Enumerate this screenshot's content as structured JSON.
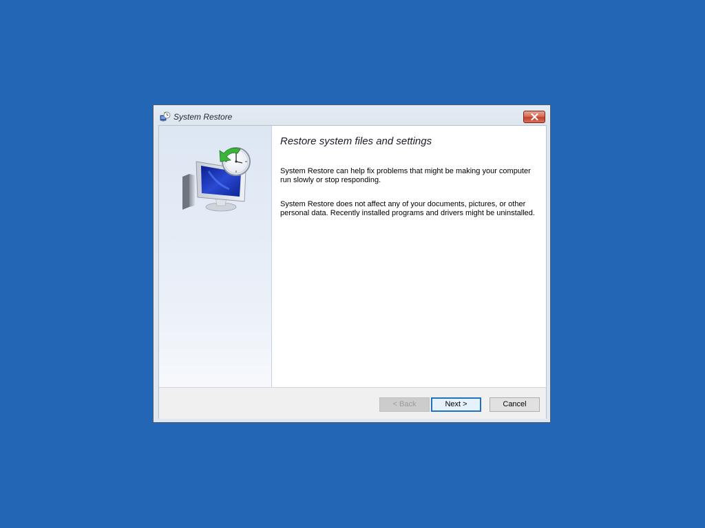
{
  "window": {
    "title": "System Restore",
    "icon": "system-restore-icon",
    "close_icon": "close-icon"
  },
  "sidebar": {
    "illustration": "computer-clock-restore-icon"
  },
  "main": {
    "heading": "Restore system files and settings",
    "paragraph1": "System Restore can help fix problems that might be making your computer run slowly or stop responding.",
    "paragraph2": "System Restore does not affect any of your documents, pictures, or other personal data. Recently installed programs and drivers might be uninstalled."
  },
  "buttons": {
    "back_label": "< Back",
    "back_enabled": false,
    "next_label": "Next >",
    "next_default": true,
    "cancel_label": "Cancel"
  },
  "colors": {
    "desktop": "#2266b5",
    "close_button": "#c5412c",
    "default_button_border": "#1f6fc2",
    "restore_arrow": "#3cb43c"
  }
}
